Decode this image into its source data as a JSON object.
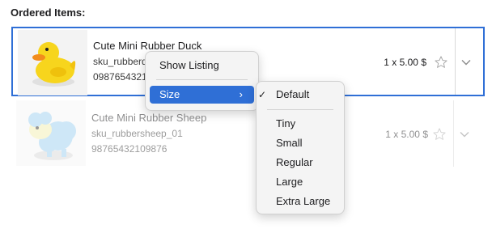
{
  "heading": "Ordered Items:",
  "items": [
    {
      "name": "Cute Mini Rubber Duck",
      "sku": "sku_rubberduck_01",
      "code": "09876543210987",
      "quantity": "1 x 5.00 $",
      "thumb_icon": "rubber-duck-image",
      "selected": true,
      "starred": false
    },
    {
      "name": "Cute Mini Rubber Sheep",
      "sku": "sku_rubbersheep_01",
      "code": "98765432109876",
      "quantity": "1 x 5.00 $",
      "thumb_icon": "rubber-sheep-image",
      "selected": false,
      "starred": false
    }
  ],
  "context_menu": {
    "items": [
      {
        "label": "Show Listing"
      },
      {
        "label": "Size",
        "has_submenu": true,
        "highlighted": true
      }
    ]
  },
  "size_menu": {
    "checked": "Default",
    "check_glyph": "✓",
    "items": [
      "Default",
      "Tiny",
      "Small",
      "Regular",
      "Large",
      "Extra Large"
    ]
  },
  "colors": {
    "accent": "#2f6fd6",
    "duck": "#f7d51d",
    "beak": "#f28c1c",
    "sheep": "#9fd0f0"
  }
}
